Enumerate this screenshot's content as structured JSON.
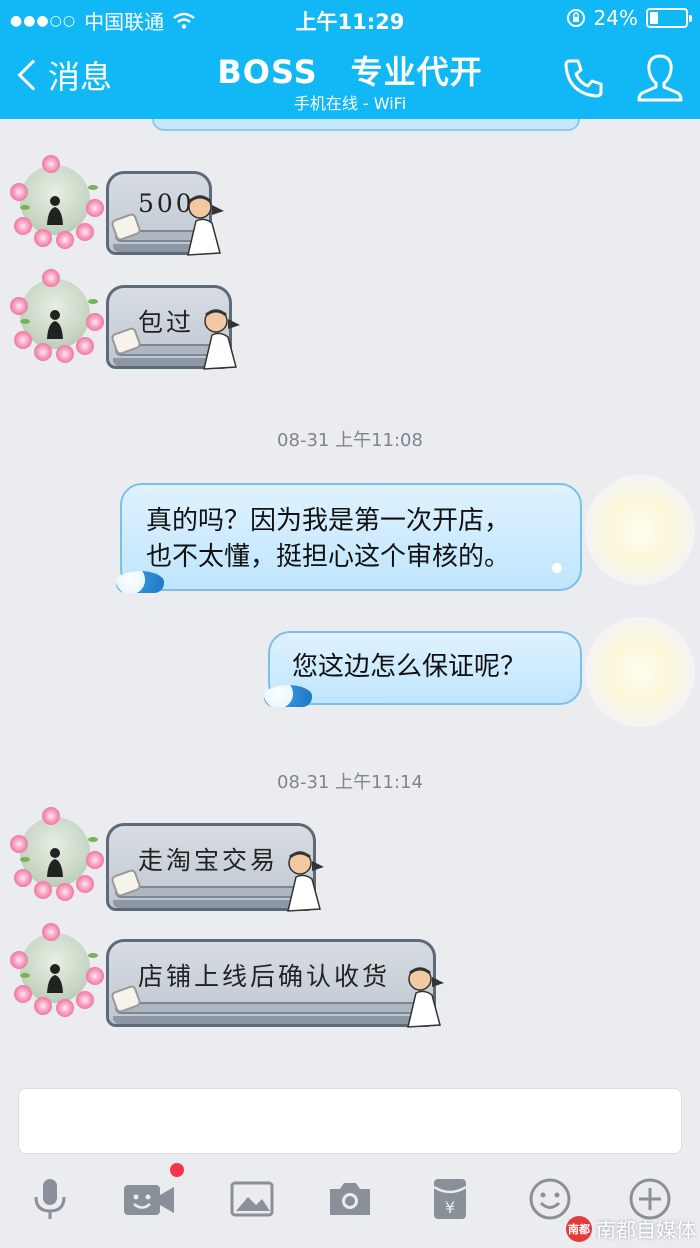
{
  "status_bar": {
    "signal_dots": "●●●○○",
    "carrier": "中国联通",
    "time": "上午11:29",
    "battery_percent": "24%",
    "battery_level": 0.24
  },
  "header": {
    "back_label": "消息",
    "title": "BOSS　专业代开",
    "subtitle": "手机在线 - WiFi",
    "icons": [
      "phone-icon",
      "profile-icon"
    ]
  },
  "messages": [
    {
      "side": "left",
      "kind": "sofa-sticker",
      "text": "500"
    },
    {
      "side": "left",
      "kind": "sofa-sticker",
      "text": "包过"
    },
    {
      "kind": "timestamp",
      "text": "08-31 上午11:08"
    },
    {
      "side": "right",
      "kind": "bubble",
      "lines": [
        "真的吗？因为我是第一次开店，",
        "也不太懂，挺担心这个审核的。"
      ]
    },
    {
      "side": "right",
      "kind": "bubble",
      "text": "您这边怎么保证呢？"
    },
    {
      "kind": "timestamp",
      "text": "08-31 上午11:14"
    },
    {
      "side": "left",
      "kind": "sofa-sticker",
      "text": "走淘宝交易"
    },
    {
      "side": "left",
      "kind": "sofa-sticker",
      "text": "店铺上线后确认收货"
    }
  ],
  "toolbar": {
    "icons": [
      "microphone-icon",
      "video-chat-icon",
      "image-icon",
      "camera-icon",
      "red-packet-icon",
      "emoji-icon",
      "plus-icon"
    ],
    "video_badge_color": "#f2374b"
  },
  "watermark": {
    "logo_text": "南都",
    "text": "南都自媒体"
  },
  "colors": {
    "header_bg": "#12b7f5",
    "chat_bg": "#ebecf0",
    "bubble_border": "#7cc0ea"
  }
}
